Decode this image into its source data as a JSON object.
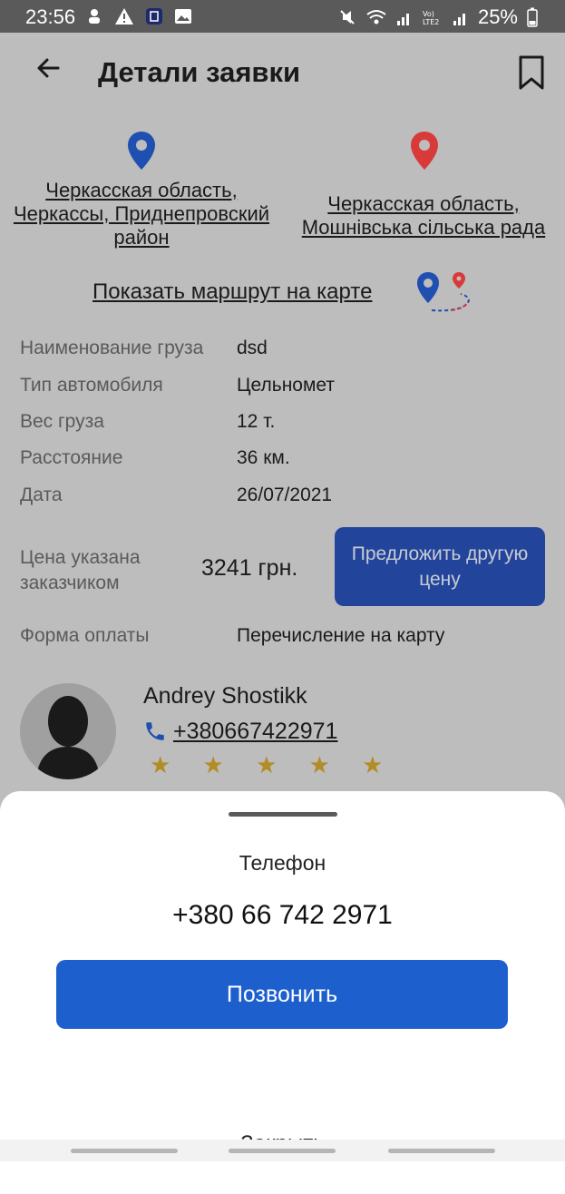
{
  "status": {
    "time": "23:56",
    "battery": "25%"
  },
  "header": {
    "title": "Детали заявки"
  },
  "route": {
    "from": "Черкасская область, Черкассы, Приднепровский район",
    "to": "Черкасская область, Мошнівська сільська рада",
    "show_map": "Показать маршрут на карте",
    "from_color": "#1f4fb0",
    "to_color": "#d83a3a"
  },
  "details": [
    {
      "label": "Наименование груза",
      "value": "dsd"
    },
    {
      "label": "Тип автомобиля",
      "value": "Цельномет"
    },
    {
      "label": "Вес груза",
      "value": "12 т."
    },
    {
      "label": "Расстояние",
      "value": "36 км."
    },
    {
      "label": "Дата",
      "value": "26/07/2021"
    }
  ],
  "price": {
    "label": "Цена указана заказчиком",
    "value": "3241 грн.",
    "offer_button": "Предложить другую цену"
  },
  "payment": {
    "label": "Форма оплаты",
    "value": "Перечисление на карту"
  },
  "customer": {
    "name": "Andrey Shostikk",
    "phone": "+380667422971",
    "rating_visible": "★ ★ ★ ★ ★"
  },
  "sheet": {
    "title": "Телефон",
    "phone": "+380 66 742 2971",
    "call_button": "Позвонить",
    "close": "Закрыть"
  }
}
